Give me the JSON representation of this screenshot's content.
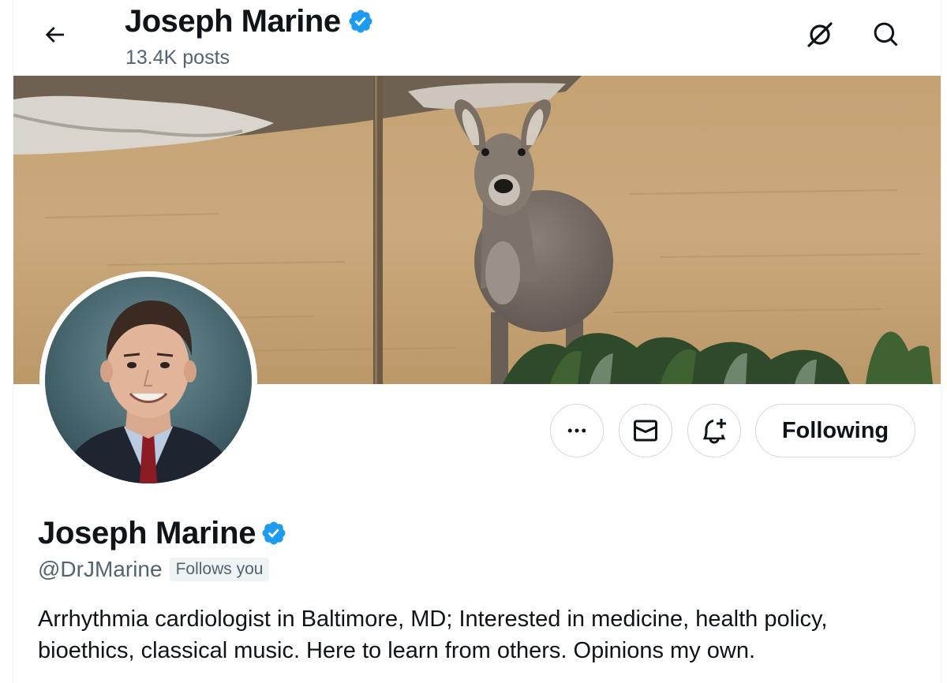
{
  "header": {
    "name": "Joseph Marine",
    "posts": "13.4K posts",
    "back_icon": "arrow-left-icon",
    "grok_icon": "grok-icon",
    "search_icon": "search-icon"
  },
  "profile": {
    "name": "Joseph Marine",
    "handle": "@DrJMarine",
    "follows_you": "Follows you",
    "bio": "Arrhythmia cardiologist in Baltimore, MD; Interested in medicine, health policy, bioethics, classical music. Here to learn from others. Opinions my own.",
    "verified_color": "#1d9bf0"
  },
  "actions": {
    "more_icon": "more-icon",
    "message_icon": "envelope-icon",
    "notify_icon": "bell-plus-icon",
    "following_label": "Following"
  },
  "banner": {
    "subject": "deer-photo"
  }
}
